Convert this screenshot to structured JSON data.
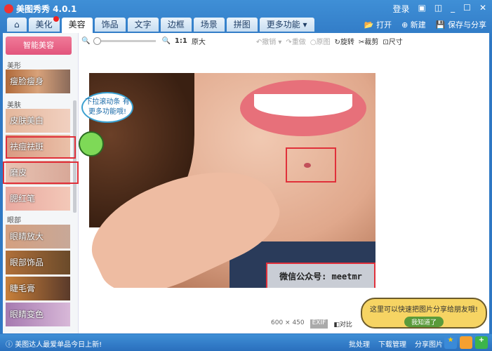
{
  "app": {
    "title": "美图秀秀 4.0.1",
    "login": "登录"
  },
  "tabs": [
    {
      "label": "美化"
    },
    {
      "label": "美容"
    },
    {
      "label": "饰品"
    },
    {
      "label": "文字"
    },
    {
      "label": "边框"
    },
    {
      "label": "场景"
    },
    {
      "label": "拼图"
    },
    {
      "label": "更多功能 ▾"
    }
  ],
  "header_buttons": {
    "open": "打开",
    "new": "新建",
    "save": "保存与分享"
  },
  "toolbar": {
    "ratio": "1:1",
    "original_size": "原大",
    "undo": "撤销",
    "redo": "重做",
    "original": "原图",
    "rotate": "旋转",
    "crop": "裁剪",
    "size": "尺寸"
  },
  "sidebar": {
    "smart": "智能美容",
    "sections": [
      {
        "title": "美形",
        "items": [
          "瘦脸瘦身"
        ]
      },
      {
        "title": "美肤",
        "items": [
          "皮肤美白",
          "祛痘祛斑",
          "磨皮",
          "腮红笔"
        ]
      },
      {
        "title": "眼部",
        "items": [
          "眼睛放大",
          "眼部饰品",
          "睫毛膏",
          "眼睛变色"
        ]
      }
    ]
  },
  "canvas": {
    "bubble": "下拉滚动条 有更多功能哦!",
    "watermark": "微信公众号: meetmr",
    "dimensions": "600 × 450",
    "exif": "EXIF",
    "compare": "对比"
  },
  "tip": {
    "text": "这里可以快速把图片分享给朋友哦!",
    "button": "我知道了"
  },
  "status": {
    "news": "美图达人最爱单品今日上新!",
    "batch": "批处理",
    "download": "下载管理",
    "share": "分享图片"
  }
}
